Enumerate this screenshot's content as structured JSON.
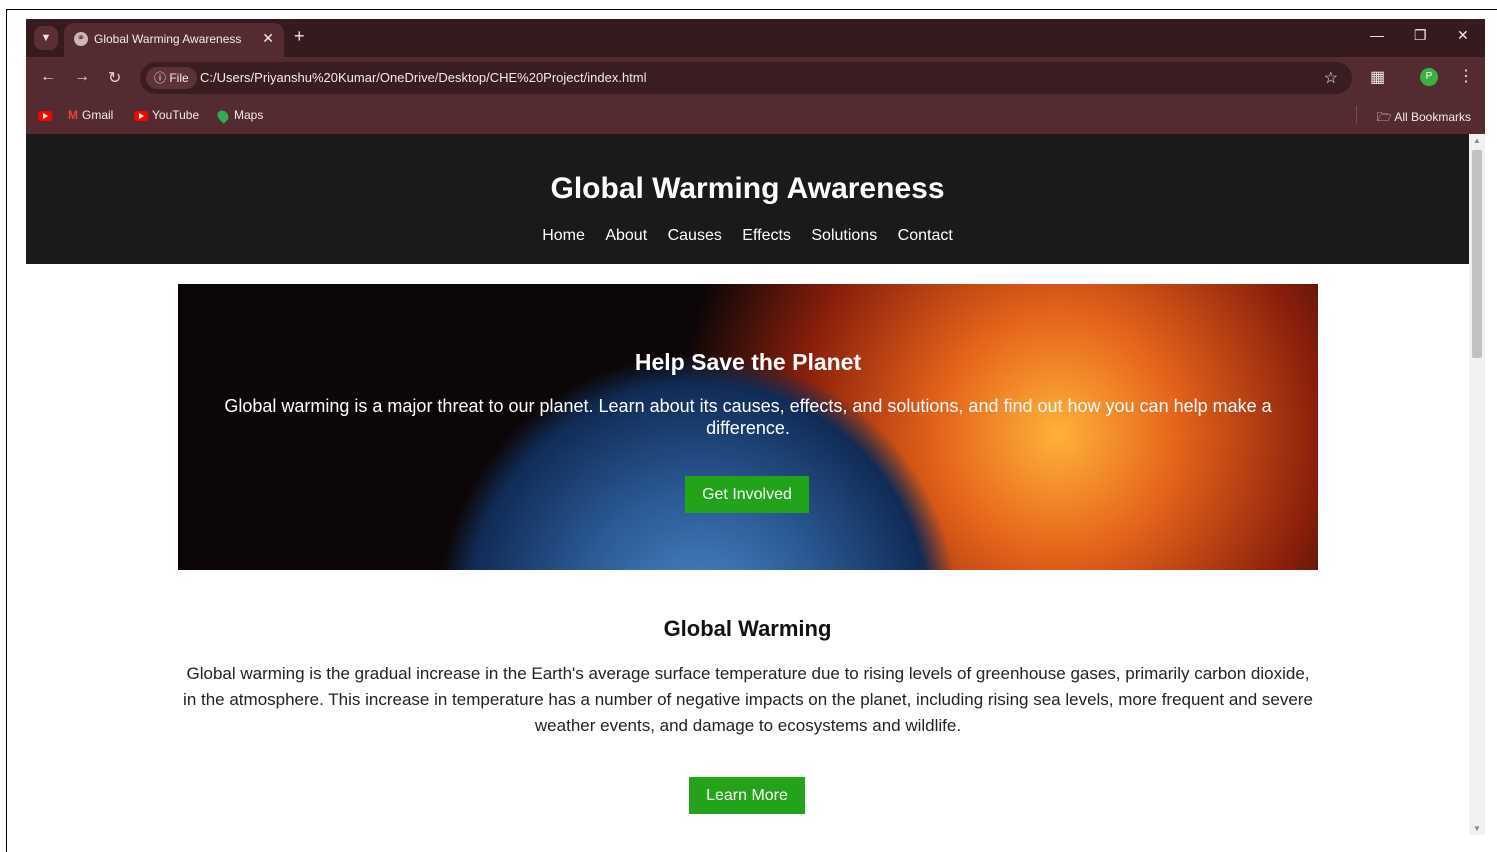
{
  "browser": {
    "tab_title": "Global Warming Awareness",
    "new_tab": "+",
    "file_label": "File",
    "url": "C:/Users/Priyanshu%20Kumar/OneDrive/Desktop/CHE%20Project/index.html",
    "profile_initial": "P",
    "bookmarks": [
      "Gmail",
      "YouTube",
      "Maps"
    ],
    "all_bookmarks": "All Bookmarks"
  },
  "site": {
    "title": "Global Warming Awareness",
    "nav": [
      "Home",
      "About",
      "Causes",
      "Effects",
      "Solutions",
      "Contact"
    ]
  },
  "hero": {
    "title": "Help Save the Planet",
    "text": "Global warming is a major threat to our planet. Learn about its causes, effects, and solutions, and find out how you can help make a difference.",
    "button": "Get Involved"
  },
  "section": {
    "title": "Global Warming",
    "text": "Global warming is the gradual increase in the Earth's average surface temperature due to rising levels of greenhouse gases, primarily carbon dioxide, in the atmosphere. This increase in temperature has a number of negative impacts on the planet, including rising sea levels, more frequent and severe weather events, and damage to ecosystems and wildlife.",
    "button": "Learn More"
  },
  "colors": {
    "header_bg": "#1a1a1a",
    "button_green": "#22a319",
    "chrome_bg": "#542b30"
  }
}
